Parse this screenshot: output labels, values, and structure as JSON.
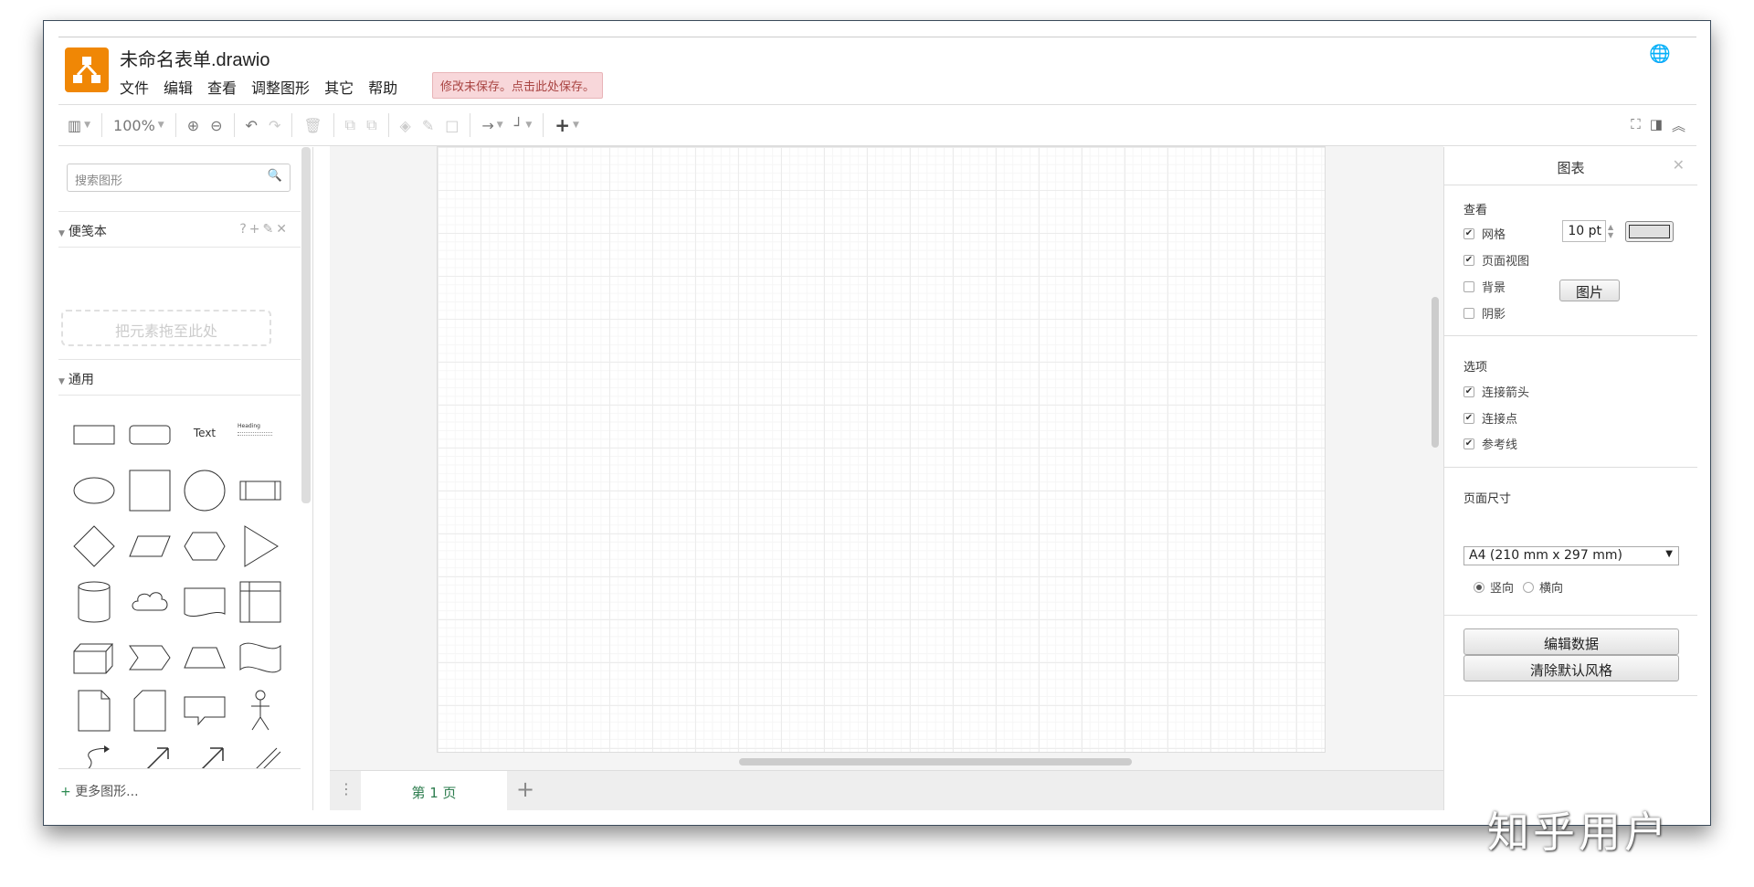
{
  "header": {
    "title": "未命名表单.drawio",
    "menu": [
      "文件",
      "编辑",
      "查看",
      "调整图形",
      "其它",
      "帮助"
    ],
    "unsaved_notice": "修改未保存。点击此处保存。",
    "logo_color": "#f08705"
  },
  "toolbar": {
    "zoom": "100%"
  },
  "sidebar": {
    "search_placeholder": "搜索图形",
    "scratchpad_title": "便笺本",
    "scratchpad_icons": "?+✎✕",
    "drop_hint": "把元素拖至此处",
    "general_title": "通用",
    "text_shape": "Text",
    "heading_shape": "Heading",
    "more_shapes": "更多图形..."
  },
  "tabs": {
    "page1": "第 1 页"
  },
  "panel": {
    "title": "图表",
    "view_heading": "查看",
    "grid": "网格",
    "grid_checked": true,
    "grid_size": "10 pt",
    "page_view": "页面视图",
    "page_view_checked": true,
    "background": "背景",
    "background_checked": false,
    "image_button": "图片",
    "shadow": "阴影",
    "shadow_checked": false,
    "options_heading": "选项",
    "connection_arrows": "连接箭头",
    "connection_points": "连接点",
    "guides": "参考线",
    "page_size_heading": "页面尺寸",
    "page_size": "A4 (210 mm x 297 mm)",
    "portrait": "竖向",
    "landscape": "横向",
    "orientation_selected": "portrait",
    "edit_data": "编辑数据",
    "clear_default_style": "清除默认风格"
  },
  "watermark": "知乎用户"
}
